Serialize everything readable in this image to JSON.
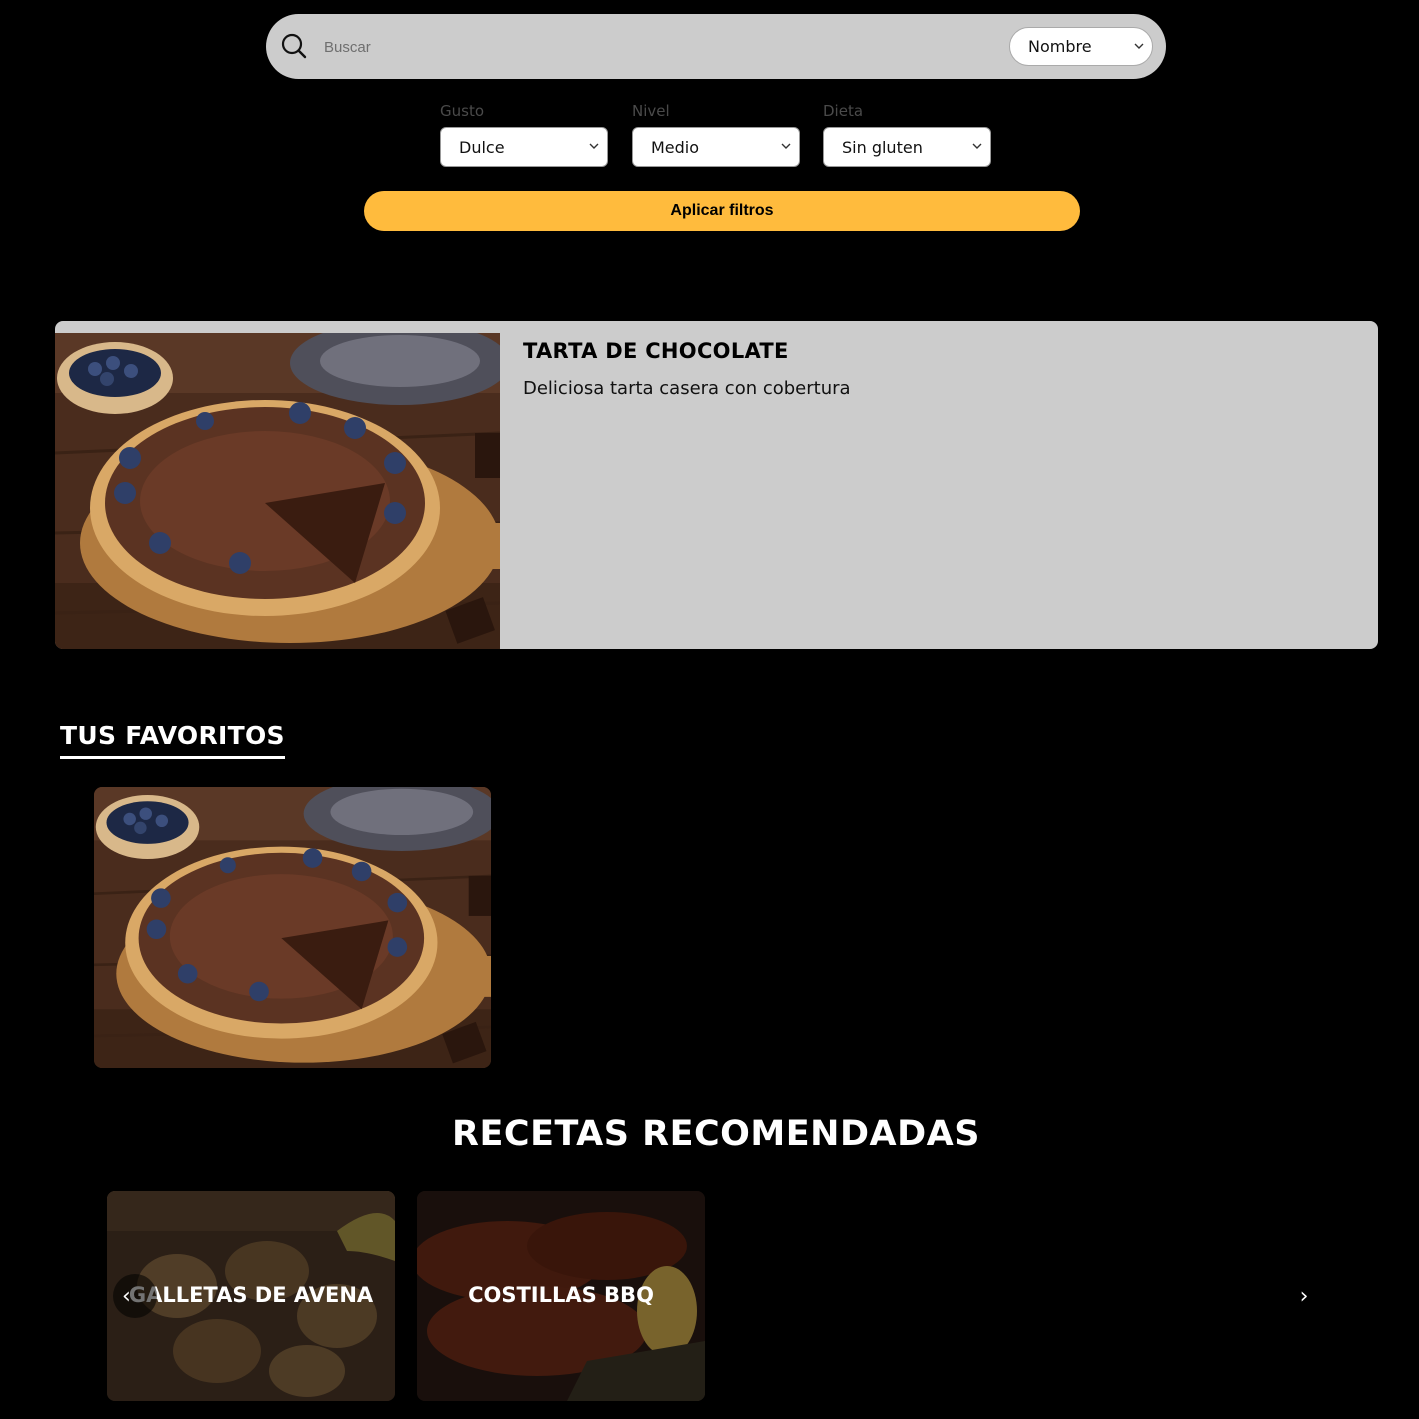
{
  "search": {
    "placeholder": "Buscar",
    "sort_selected": "Nombre"
  },
  "filters": [
    {
      "label": "Gusto",
      "selected": "Dulce"
    },
    {
      "label": "Nivel",
      "selected": "Medio"
    },
    {
      "label": "Dieta",
      "selected": "Sin gluten"
    }
  ],
  "apply_label": "Aplicar filtros",
  "featured": {
    "title": "TARTA DE CHOCOLATE",
    "description": "Deliciosa tarta casera con cobertura"
  },
  "favorites": {
    "heading": "TUS FAVORITOS"
  },
  "recommended": {
    "heading": "RECETAS RECOMENDADAS",
    "items": [
      {
        "title": "GALLETAS DE AVENA"
      },
      {
        "title": "COSTILLAS BBQ"
      }
    ],
    "prev_glyph": "‹",
    "next_glyph": "›"
  },
  "colors": {
    "background": "#000000",
    "panel": "#cccccc",
    "accent": "#ffbb3d"
  }
}
